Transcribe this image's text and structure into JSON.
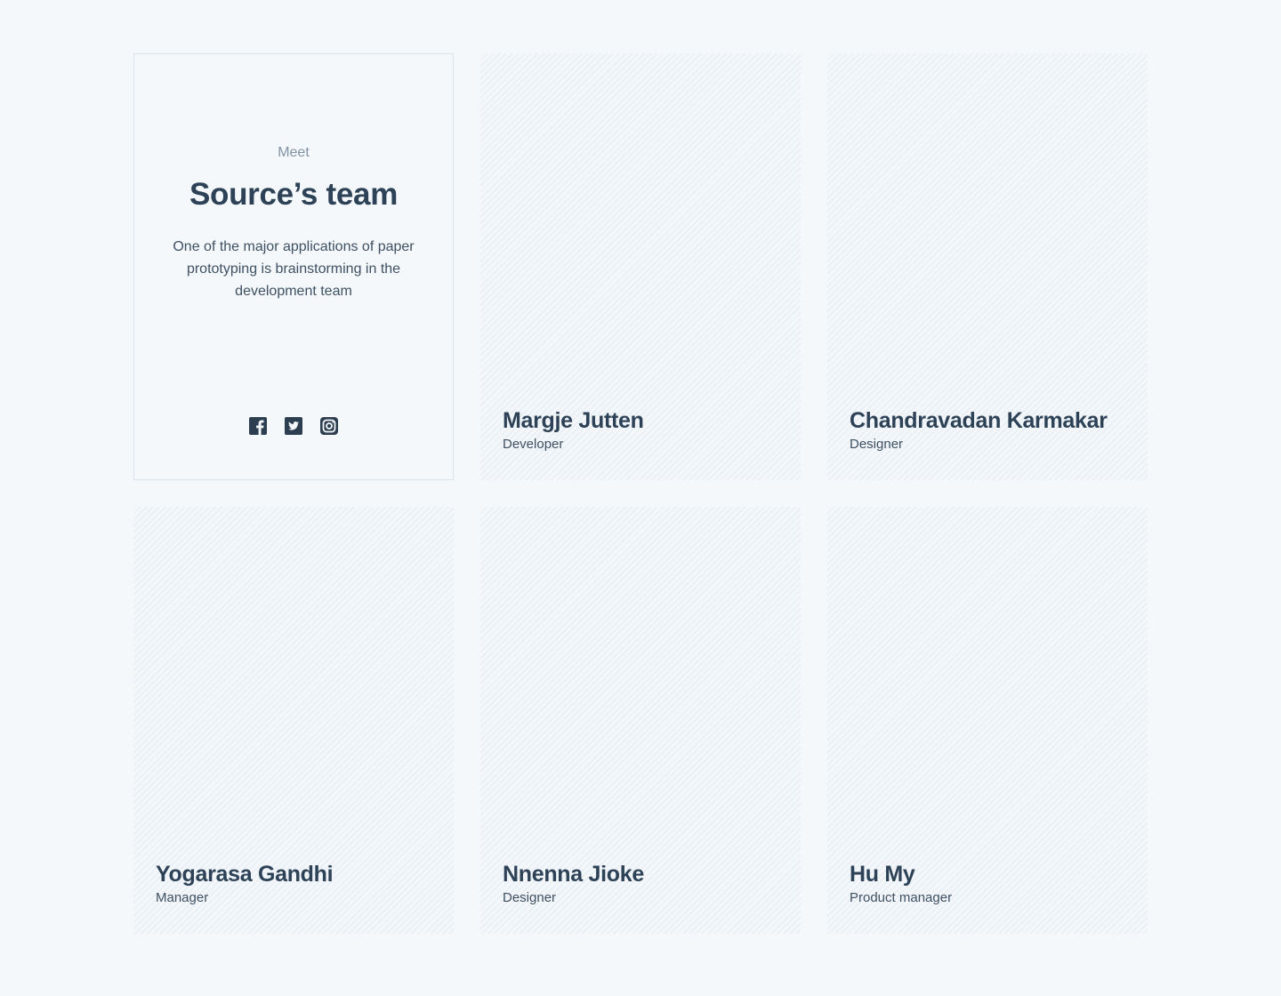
{
  "intro": {
    "eyebrow": "Meet",
    "title": "Source’s team",
    "description": "One of the major applications of paper prototyping is brainstorming in the development team",
    "social": [
      {
        "name": "facebook",
        "icon": "facebook-icon"
      },
      {
        "name": "twitter",
        "icon": "twitter-icon"
      },
      {
        "name": "instagram",
        "icon": "instagram-icon"
      }
    ]
  },
  "members": [
    {
      "name": "Margje Jutten",
      "role": "Developer"
    },
    {
      "name": "Chandravadan Karmakar",
      "role": "Designer"
    },
    {
      "name": "Yogarasa Gandhi",
      "role": "Manager"
    },
    {
      "name": "Nnenna Jioke",
      "role": "Designer"
    },
    {
      "name": "Hu My",
      "role": "Product manager"
    }
  ],
  "colors": {
    "background": "#f4f8fb",
    "text_dark": "#2d4257",
    "text_muted": "#8293a4",
    "icon": "#2c3e50"
  }
}
